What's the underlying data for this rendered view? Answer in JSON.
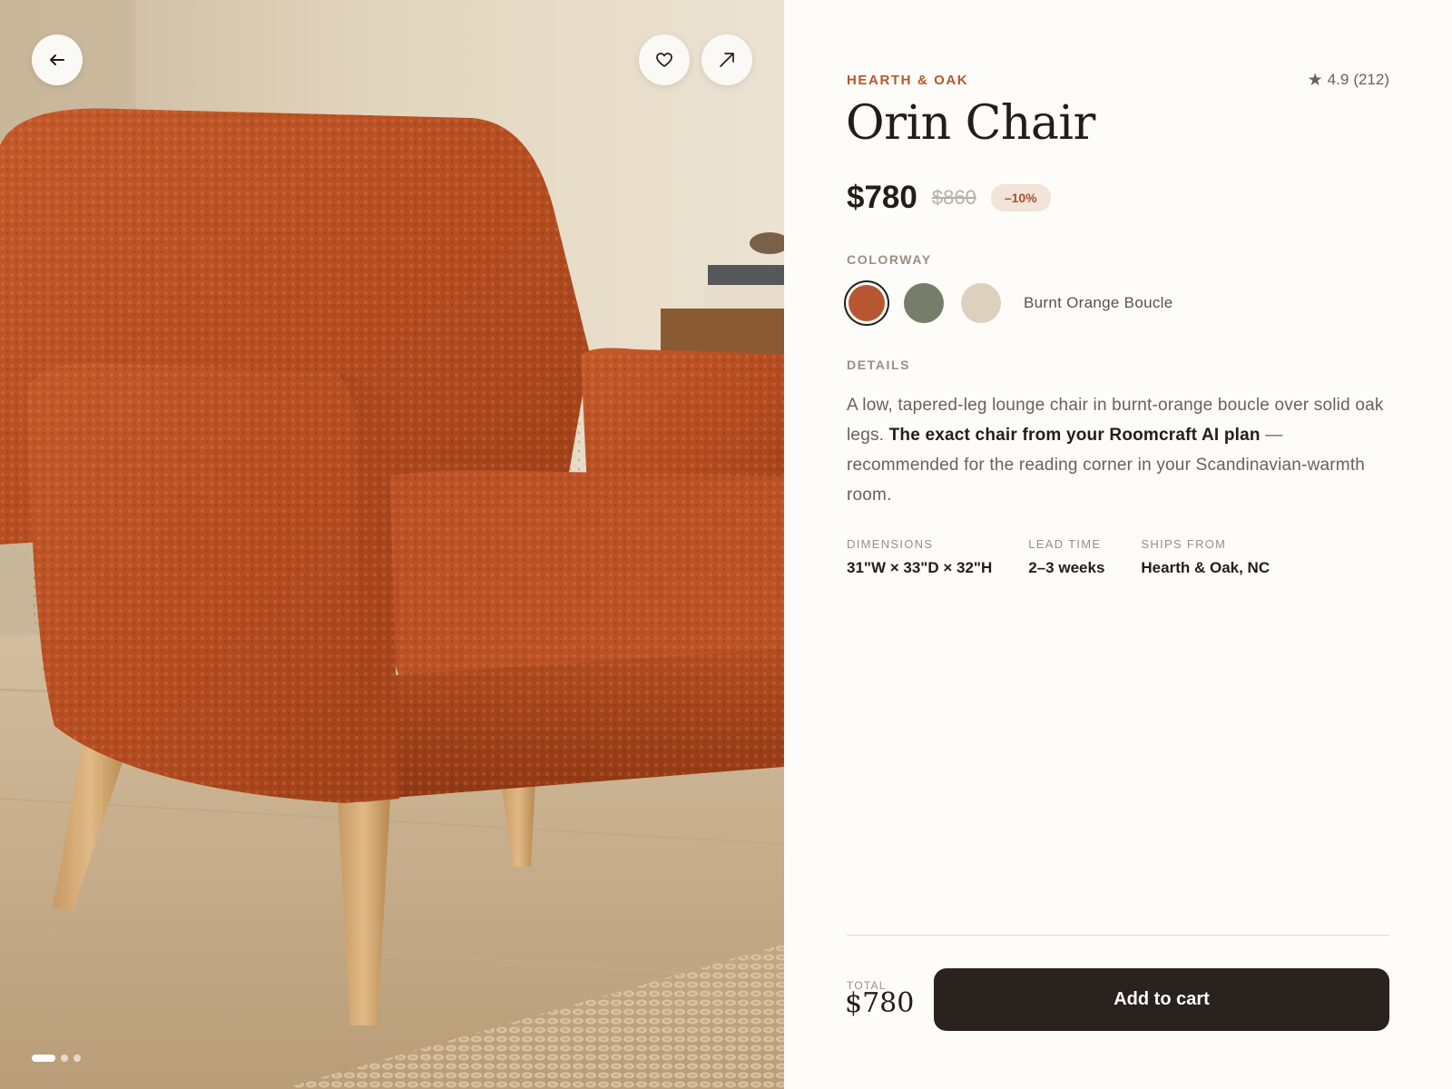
{
  "product": {
    "brand": "HEARTH & OAK",
    "rating": "4.9",
    "reviews": "(212)",
    "name": "Orin Chair",
    "price": "$780",
    "old_price": "$860",
    "discount": "–10%"
  },
  "colorway": {
    "label": "COLORWAY",
    "selected_name": "Burnt Orange Boucle",
    "swatches": [
      {
        "color": "#b95632",
        "selected": true
      },
      {
        "color": "#767d68",
        "selected": false
      },
      {
        "color": "#ddd0bf",
        "selected": false
      }
    ]
  },
  "details": {
    "label": "DETAILS",
    "text_before": "A low, tapered-leg lounge chair in burnt-orange boucle over solid oak legs. ",
    "text_bold": "The exact chair from your Roomcraft AI plan",
    "text_after": " — recommended for the reading corner in your Scandinavian-warmth room."
  },
  "specs": [
    {
      "label": "DIMENSIONS",
      "value": "31\"W × 33\"D × 32\"H"
    },
    {
      "label": "LEAD TIME",
      "value": "2–3 weeks"
    },
    {
      "label": "SHIPS FROM",
      "value": "Hearth & Oak, NC"
    }
  ],
  "footer": {
    "total_label": "TOTAL",
    "total_value": "$780",
    "cart_label": "Add to cart"
  },
  "gallery": {
    "image_count": 3,
    "active_index": 0
  },
  "icons": {
    "back": "arrow-left-icon",
    "favorite": "heart-icon",
    "share": "arrow-up-right-icon",
    "rating": "star-icon"
  },
  "colors": {
    "accent": "#b3592b",
    "dark": "#2a221d",
    "muted": "#9a8f83"
  }
}
